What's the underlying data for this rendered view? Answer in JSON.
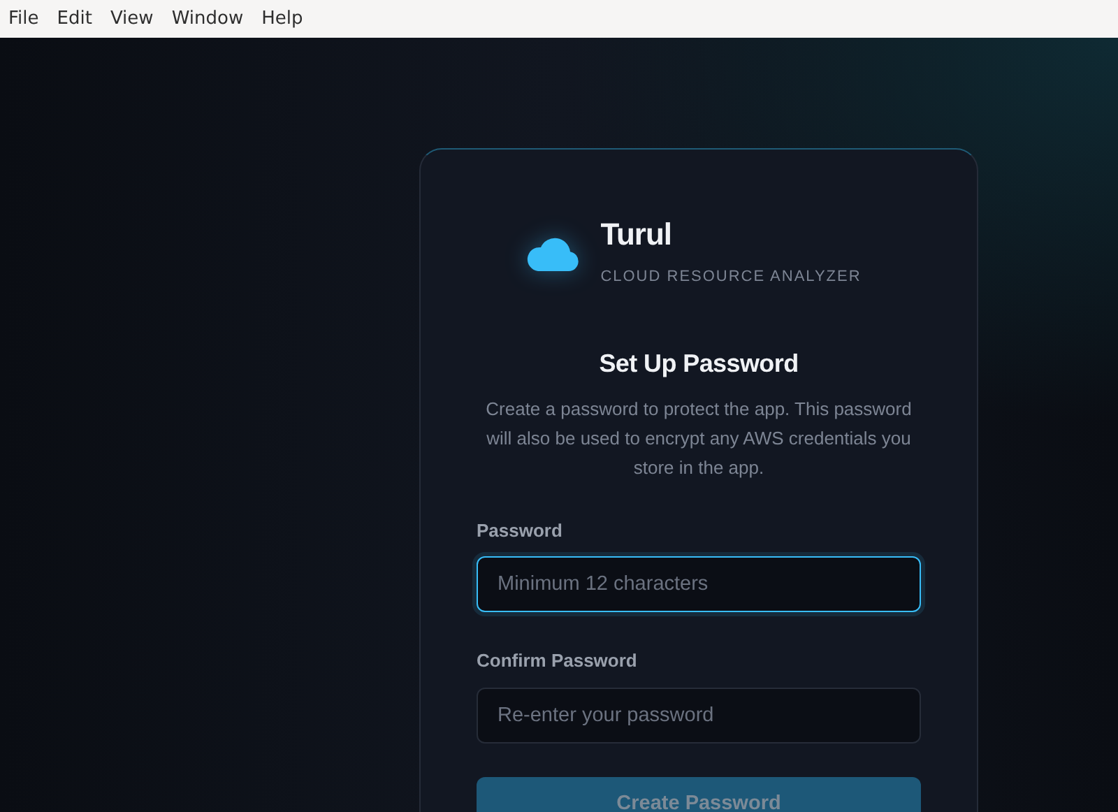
{
  "menu_bar": [
    "File",
    "Edit",
    "View",
    "Window",
    "Help"
  ],
  "brand": {
    "name": "Turul",
    "tagline": "CLOUD RESOURCE ANALYZER"
  },
  "heading": "Set Up Password",
  "description": "Create a password to protect the app. This password will also be used to encrypt any AWS credentials you store in the app.",
  "fields": [
    {
      "label": "Password",
      "placeholder": "Minimum 12 characters",
      "focused": true
    },
    {
      "label": "Confirm Password",
      "placeholder": "Re-enter your password",
      "focused": false
    }
  ],
  "submit": {
    "label": "Create Password",
    "disabled": true
  }
}
